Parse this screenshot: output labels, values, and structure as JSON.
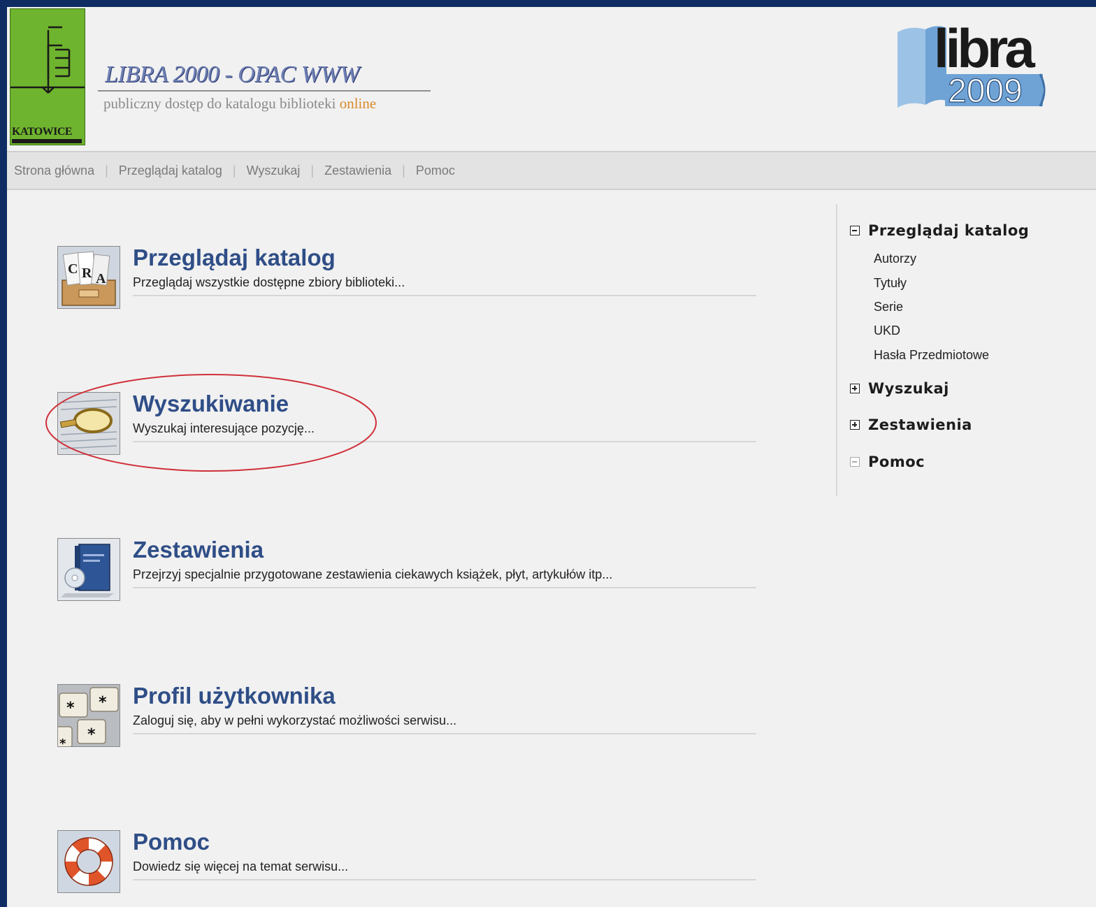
{
  "header": {
    "logo_text": "KATOWICE",
    "title": "LIBRA 2000 - OPAC WWW",
    "subtitle_prefix": "publiczny dostęp do katalogu biblioteki ",
    "subtitle_highlight": "online",
    "brand_logo_word": "libra",
    "brand_logo_year": "2009"
  },
  "topnav": {
    "items": [
      "Strona główna",
      "Przeglądaj katalog",
      "Wyszukaj",
      "Zestawienia",
      "Pomoc"
    ],
    "separator": "|"
  },
  "main": {
    "items": [
      {
        "title": "Przeglądaj katalog",
        "description": "Przeglądaj wszystkie dostępne zbiory biblioteki...",
        "icon": "card-catalog-icon"
      },
      {
        "title": "Wyszukiwanie",
        "description": "Wyszukaj interesujące pozycję...",
        "icon": "magnifier-icon"
      },
      {
        "title": "Zestawienia",
        "description": "Przejrzyj specjalnie przygotowane zestawienia ciekawych książek, płyt, artykułów itp...",
        "icon": "book-cd-icon"
      },
      {
        "title": "Profil użytkownika",
        "description": "Zaloguj się, aby w pełni wykorzystać możliwości serwisu...",
        "icon": "keyboard-keys-icon"
      },
      {
        "title": "Pomoc",
        "description": "Dowiedz się więcej na temat serwisu...",
        "icon": "lifebuoy-icon"
      }
    ]
  },
  "sidebar": {
    "groups": [
      {
        "label": "Przeglądaj katalog",
        "state": "expanded",
        "children": [
          "Autorzy",
          "Tytuły",
          "Serie",
          "UKD",
          "Hasła Przedmiotowe"
        ]
      },
      {
        "label": "Wyszukaj",
        "state": "collapsed"
      },
      {
        "label": "Zestawienia",
        "state": "collapsed"
      },
      {
        "label": "Pomoc",
        "state": "leaf"
      }
    ]
  },
  "colors": {
    "frame": "#0f2d63",
    "title_blue": "#2f4e87",
    "online_orange": "#d98a2a",
    "logo_green": "#6fb42e",
    "highlight_red": "#d0303a"
  }
}
